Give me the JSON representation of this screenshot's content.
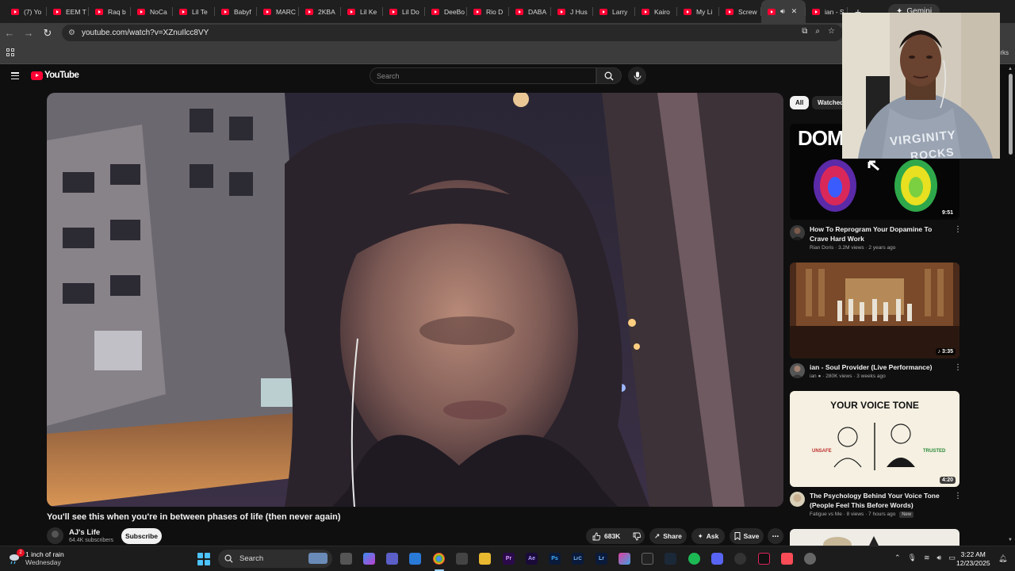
{
  "browser": {
    "tabs": [
      {
        "title": "(7) Yo"
      },
      {
        "title": "EEM T"
      },
      {
        "title": "Raq b"
      },
      {
        "title": "NoCa"
      },
      {
        "title": "Lil Te"
      },
      {
        "title": "Babyf"
      },
      {
        "title": "MARC"
      },
      {
        "title": "2KBA"
      },
      {
        "title": "Lil Ke"
      },
      {
        "title": "Lil Do"
      },
      {
        "title": "DeeBo"
      },
      {
        "title": "Rio D"
      },
      {
        "title": "DABA"
      },
      {
        "title": "J Hus"
      },
      {
        "title": "Larry"
      },
      {
        "title": "Kairo"
      },
      {
        "title": "My Li"
      },
      {
        "title": "Screw"
      }
    ],
    "active_tab": {
      "title": "ian - S"
    },
    "new_tab": "+",
    "gemini_label": "Gemini",
    "url": "youtube.com/watch?v=XZnuIlcc8VY",
    "bookmarks_right": "rks"
  },
  "youtube": {
    "logo_text": "YouTube",
    "search_placeholder": "Search",
    "video": {
      "title": "You'll see this when you're in between phases of life (then never again)",
      "channel": "AJ's Life",
      "subscribers": "64.4K subscribers",
      "subscribe_label": "Subscribe",
      "likes": "683K",
      "share_label": "Share",
      "ask_label": "Ask",
      "save_label": "Save"
    },
    "chips": [
      "All",
      "Watched"
    ],
    "recommendations": [
      {
        "title": "How To Reprogram Your Dopamine To Crave Hard Work",
        "channel": "Rian Doris",
        "meta": "3.2M views · 2 years ago",
        "duration": "9:51",
        "thumb_text": "DOM"
      },
      {
        "title": "ian - Soul Provider (Live Performance)",
        "channel": "ian",
        "meta": "280K views · 3 weeks ago",
        "duration": "3:35"
      },
      {
        "title": "The Psychology Behind Your Voice Tone (People Feel This Before Words)",
        "channel": "Fatigue vs Me",
        "meta": "8 views · 7 hours ago",
        "badge": "New",
        "duration": "4:20",
        "thumb_title": "YOUR VOICE TONE",
        "thumb_left": "UNSAFE",
        "thumb_right": "TRUSTED"
      }
    ]
  },
  "webcam": {
    "shirt_text_1": "VIRGINITY",
    "shirt_text_2": "ROCKS"
  },
  "taskbar": {
    "notification_count": "2",
    "weather_line1": "1 inch of rain",
    "weather_line2": "Wednesday",
    "search_label": "Search",
    "app_labels": [
      "Pr",
      "Ae",
      "Ps",
      "LrC",
      "Lr"
    ],
    "time": "3:22 AM",
    "date": "12/23/2025"
  },
  "colors": {
    "accent_red": "#ff0033",
    "background": "#0f0f0f",
    "chip_active": "#f1f1f1",
    "start_blue": "#4cc2ff"
  }
}
